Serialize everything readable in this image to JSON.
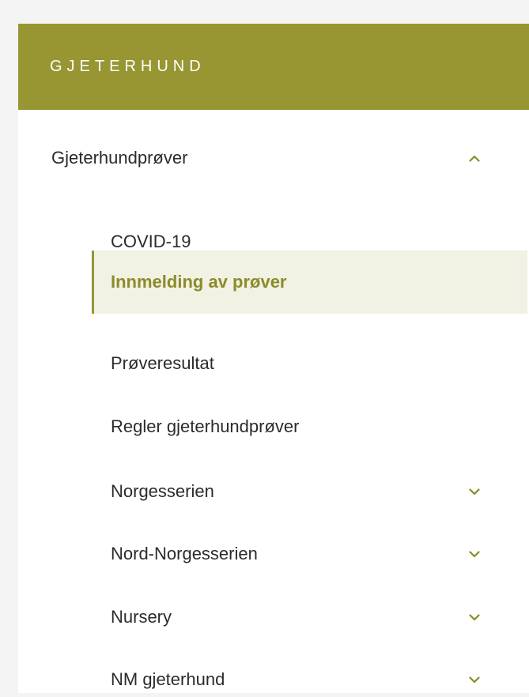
{
  "header": {
    "title": "GJETERHUND"
  },
  "colors": {
    "accent": "#979633",
    "active_bg": "#f1f1e4",
    "active_text": "#8c8b2c",
    "text": "#2b2b2b"
  },
  "menu": {
    "parent": {
      "label": "Gjeterhundprøver",
      "icon": "chevron-up-icon",
      "expanded": true
    },
    "items": [
      {
        "label": "COVID-19"
      },
      {
        "label": "Innmelding av prøver",
        "active": true
      },
      {
        "label": "Prøveresultat"
      },
      {
        "label": "Regler gjeterhundprøver"
      },
      {
        "label": "Norgesserien",
        "icon": "chevron-down-icon"
      },
      {
        "label": "Nord-Norgesserien",
        "icon": "chevron-down-icon"
      },
      {
        "label": "Nursery",
        "icon": "chevron-down-icon"
      },
      {
        "label": "NM gjeterhund",
        "icon": "chevron-down-icon"
      }
    ]
  }
}
